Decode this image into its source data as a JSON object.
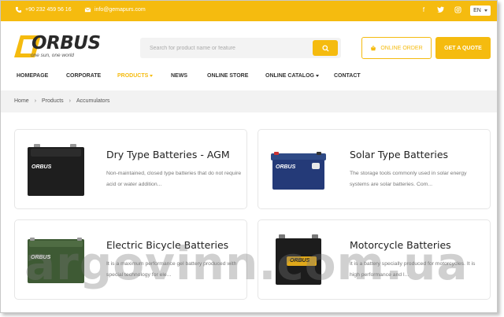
{
  "topbar": {
    "phone": "+90 232 459 56 16",
    "email": "info@gemapurs.com",
    "language": "EN"
  },
  "header": {
    "logo_text": "ORBUS",
    "logo_tagline": "one sun, one world",
    "search_placeholder": "Search for product name or feature",
    "online_order_label": "ONLINE ORDER",
    "quote_label": "GET A QUOTE"
  },
  "nav": {
    "items": [
      {
        "label": "HOMEPAGE"
      },
      {
        "label": "CORPORATE"
      },
      {
        "label": "PRODUCTS"
      },
      {
        "label": "NEWS"
      },
      {
        "label": "ONLINE STORE"
      },
      {
        "label": "ONLINE CATALOG"
      },
      {
        "label": "CONTACT"
      }
    ]
  },
  "breadcrumb": [
    "Home",
    "Products",
    "Accumulators"
  ],
  "products": [
    {
      "title": "Dry Type Batteries - AGM",
      "desc": "Non-maintained, closed type batteries that do not require acid or water addition..."
    },
    {
      "title": "Solar Type Batteries",
      "desc": "The storage tools commonly used in solar energy systems are solar batteries. Com..."
    },
    {
      "title": "Electric Bicycle Batteries",
      "desc": "It is a maximum performance gel battery produced with special technology for ele..."
    },
    {
      "title": "Motorcycle Batteries",
      "desc": "It is a battery specially produced for motorcycles. It is high performance and l..."
    }
  ],
  "watermark": "argovinn.com.ua",
  "colors": {
    "accent": "#f5bb0f",
    "breadcrumb_bg": "#f2f2f2"
  }
}
